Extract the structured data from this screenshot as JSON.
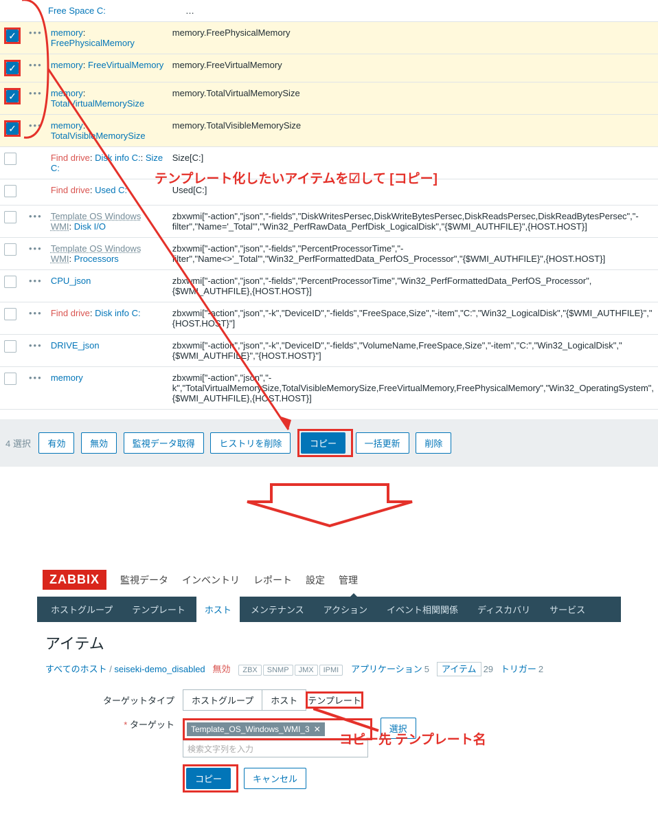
{
  "rows": [
    {
      "selected": true,
      "dots": true,
      "name_parts": [
        {
          "t": "memory",
          "c": "link"
        },
        {
          "t": ": ",
          "c": "sep"
        },
        {
          "t": "FreePhysicalMemory",
          "c": "link"
        }
      ],
      "key": "memory.FreePhysicalMemory"
    },
    {
      "selected": true,
      "dots": true,
      "name_parts": [
        {
          "t": "memory",
          "c": "link"
        },
        {
          "t": ": ",
          "c": "sep"
        },
        {
          "t": "FreeVirtualMemory",
          "c": "link"
        }
      ],
      "key": "memory.FreeVirtualMemory"
    },
    {
      "selected": true,
      "dots": true,
      "name_parts": [
        {
          "t": "memory",
          "c": "link"
        },
        {
          "t": ": ",
          "c": "sep"
        },
        {
          "t": "TotalVirtualMemorySize",
          "c": "link"
        }
      ],
      "key": "memory.TotalVirtualMemorySize"
    },
    {
      "selected": true,
      "dots": true,
      "name_parts": [
        {
          "t": "memory",
          "c": "link"
        },
        {
          "t": ": ",
          "c": "sep"
        },
        {
          "t": "TotalVisibleMemorySize",
          "c": "link"
        }
      ],
      "key": "memory.TotalVisibleMemorySize"
    },
    {
      "selected": false,
      "dots": false,
      "name_parts": [
        {
          "t": "Find drive",
          "c": "orange-link"
        },
        {
          "t": ": ",
          "c": "sep"
        },
        {
          "t": "Disk info C:",
          "c": "link"
        },
        {
          "t": ": ",
          "c": "sep"
        },
        {
          "t": "Size C:",
          "c": "link"
        }
      ],
      "key": "Size[C:]"
    },
    {
      "selected": false,
      "dots": false,
      "name_parts": [
        {
          "t": "Find drive",
          "c": "orange-link"
        },
        {
          "t": ": ",
          "c": "sep"
        },
        {
          "t": "Used C:",
          "c": "link"
        }
      ],
      "key": "Used[C:]"
    },
    {
      "selected": false,
      "dots": true,
      "name_parts": [
        {
          "t": "Template OS Windows WMI",
          "c": "link",
          "u": true
        },
        {
          "t": ": ",
          "c": "sep"
        },
        {
          "t": "Disk I/O",
          "c": "link"
        }
      ],
      "key": "zbxwmi[\"-action\",\"json\",\"-fields\",\"DiskWritesPersec,DiskWriteBytesPersec,DiskReadsPersec,DiskReadBytesPersec\",\"-filter\",\"Name='_Total'\",\"Win32_PerfRawData_PerfDisk_LogicalDisk\",\"{$WMI_AUTHFILE}\",{HOST.HOST}]"
    },
    {
      "selected": false,
      "dots": true,
      "name_parts": [
        {
          "t": "Template OS Windows WMI",
          "c": "link",
          "u": true
        },
        {
          "t": ": ",
          "c": "sep"
        },
        {
          "t": "Processors",
          "c": "link"
        }
      ],
      "key": "zbxwmi[\"-action\",\"json\",\"-fields\",\"PercentProcessorTime\",\"-filter\",\"Name<>'_Total'\",\"Win32_PerfFormattedData_PerfOS_Processor\",\"{$WMI_AUTHFILE}\",{HOST.HOST}]"
    },
    {
      "selected": false,
      "dots": true,
      "name_parts": [
        {
          "t": "CPU_json",
          "c": "link"
        }
      ],
      "key": "zbxwmi[\"-action\",\"json\",\"-fields\",\"PercentProcessorTime\",\"Win32_PerfFormattedData_PerfOS_Processor\",{$WMI_AUTHFILE},{HOST.HOST}]"
    },
    {
      "selected": false,
      "dots": true,
      "name_parts": [
        {
          "t": "Find drive",
          "c": "orange-link"
        },
        {
          "t": ": ",
          "c": "sep"
        },
        {
          "t": "Disk info C:",
          "c": "link"
        }
      ],
      "key": "zbxwmi[\"-action\",\"json\",\"-k\",\"DeviceID\",\"-fields\",\"FreeSpace,Size\",\"-item\",\"C:\",\"Win32_LogicalDisk\",\"{$WMI_AUTHFILE}\",\"{HOST.HOST}\"]"
    },
    {
      "selected": false,
      "dots": true,
      "name_parts": [
        {
          "t": "DRIVE_json",
          "c": "link"
        }
      ],
      "key": "zbxwmi[\"-action\",\"json\",\"-k\",\"DeviceID\",\"-fields\",\"VolumeName,FreeSpace,Size\",\"-item\",\"C:\",\"Win32_LogicalDisk\",\"{$WMI_AUTHFILE}\",\"{HOST.HOST}\"]"
    },
    {
      "selected": false,
      "dots": true,
      "name_parts": [
        {
          "t": "memory",
          "c": "link"
        }
      ],
      "key": "zbxwmi[\"-action\",\"json\",\"-k\",\"TotalVirtualMemorySize,TotalVisibleMemorySize,FreeVirtualMemory,FreePhysicalMemory\",\"Win32_OperatingSystem\",{$WMI_AUTHFILE},{HOST.HOST}]"
    }
  ],
  "top_row_name": "Free Space C:",
  "footer": {
    "sel": "4 選択",
    "enable": "有効",
    "disable": "無効",
    "check": "監視データ取得",
    "clear": "ヒストリを削除",
    "copy": "コピー",
    "mass": "一括更新",
    "delete": "削除"
  },
  "annot1": "テンプレート化したいアイテムを☑して [コピー]",
  "annot2": "コピー先 テンプレート名",
  "logo": "ZABBIX",
  "topnav": [
    "監視データ",
    "インベントリ",
    "レポート",
    "設定",
    "管理"
  ],
  "subnav": [
    "ホストグループ",
    "テンプレート",
    "ホスト",
    "メンテナンス",
    "アクション",
    "イベント相関関係",
    "ディスカバリ",
    "サービス"
  ],
  "subnav_active": 2,
  "page_title": "アイテム",
  "crumbs": {
    "all": "すべてのホスト",
    "host": "seiseki-demo_disabled",
    "disabled": "無効",
    "badges": [
      "ZBX",
      "SNMP",
      "JMX",
      "IPMI"
    ],
    "app": "アプリケーション",
    "app_n": "5",
    "item": "アイテム",
    "item_n": "29",
    "trig": "トリガー",
    "trig_n": "2"
  },
  "form": {
    "target_type": "ターゲットタイプ",
    "opt_hg": "ホストグループ",
    "opt_host": "ホスト",
    "opt_tpl": "テンプレート",
    "target": "ターゲット",
    "tag": "Template_OS_Windows_WMI_3",
    "search_ph": "検索文字列を入力",
    "select": "選択",
    "copy": "コピー",
    "cancel": "キャンセル"
  }
}
